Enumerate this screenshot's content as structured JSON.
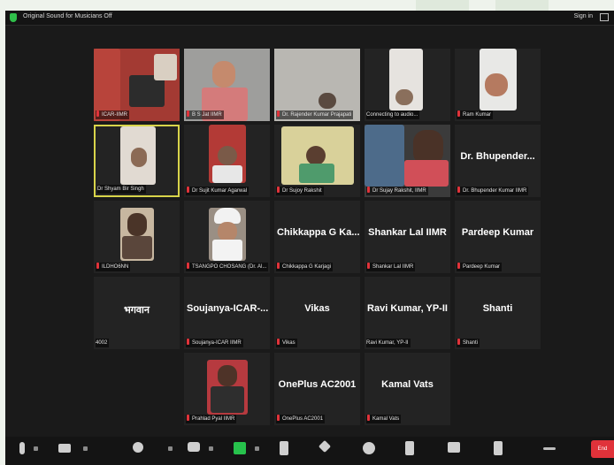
{
  "topbar": {
    "audio_text": "Original Sound for Musicians Off",
    "signin": "Sign in"
  },
  "participants": [
    {
      "id": "p1",
      "label": "ICAR-IIMR",
      "big": ""
    },
    {
      "id": "p2",
      "label": "B S Jat IIMR",
      "big": ""
    },
    {
      "id": "p3",
      "label": "Dr. Rajender Kumar Prajapati",
      "big": ""
    },
    {
      "id": "p4",
      "label": "Connecting to audio...",
      "big": ""
    },
    {
      "id": "p5",
      "label": "Ram Kumar",
      "big": ""
    },
    {
      "id": "p6",
      "label": "Dr Shyam Bir Singh",
      "big": ""
    },
    {
      "id": "p7",
      "label": "Dr Sujit Kumar Agarwal",
      "big": ""
    },
    {
      "id": "p8",
      "label": "Dr Sujoy Rakshit",
      "big": ""
    },
    {
      "id": "p9",
      "label": "Dr Sujay Rakshit, IIMR",
      "big": ""
    },
    {
      "id": "p10",
      "label": "Dr. Bhupender Kumar IIMR",
      "big": "Dr. Bhupender..."
    },
    {
      "id": "p11",
      "label": "ILDHO6NN",
      "big": ""
    },
    {
      "id": "p12",
      "label": "TSANGPO CHOSANG (Dr. Al...",
      "big": ""
    },
    {
      "id": "p13",
      "label": "Chikkappa G Karjagi",
      "big": "Chikkappa G Ka..."
    },
    {
      "id": "p14",
      "label": "Shankar Lal IIMR",
      "big": "Shankar Lal IIMR"
    },
    {
      "id": "p15",
      "label": "Pardeep Kumar",
      "big": "Pardeep Kumar"
    },
    {
      "id": "p16",
      "label": "4002",
      "big": "भगवान"
    },
    {
      "id": "p17",
      "label": "Soujanya-ICAR IIMR",
      "big": "Soujanya-ICAR-..."
    },
    {
      "id": "p18",
      "label": "Vikas",
      "big": "Vikas"
    },
    {
      "id": "p19",
      "label": "Ravi Kumar, YP-II",
      "big": "Ravi Kumar, YP-II"
    },
    {
      "id": "p20",
      "label": "Shanti",
      "big": "Shanti"
    },
    {
      "id": "p21",
      "label": "Prahlad Pyal IIMR",
      "big": ""
    },
    {
      "id": "p22",
      "label": "OnePlus AC2001",
      "big": "OnePlus AC2001"
    },
    {
      "id": "p23",
      "label": "Kamal Vats",
      "big": "Kamal Vats"
    }
  ],
  "bottombar": {
    "end_label": "End"
  },
  "icons": [
    "mic-icon",
    "video-icon",
    "participants-icon",
    "chat-icon",
    "share-screen-icon",
    "record-icon",
    "reactions-icon",
    "apps-icon",
    "whiteboard-icon",
    "notes-icon",
    "more-icon"
  ],
  "colors": {
    "active_speaker": "#d8d44a",
    "muted": "#e0333a",
    "share": "#27c24c",
    "end": "#e0323a"
  }
}
